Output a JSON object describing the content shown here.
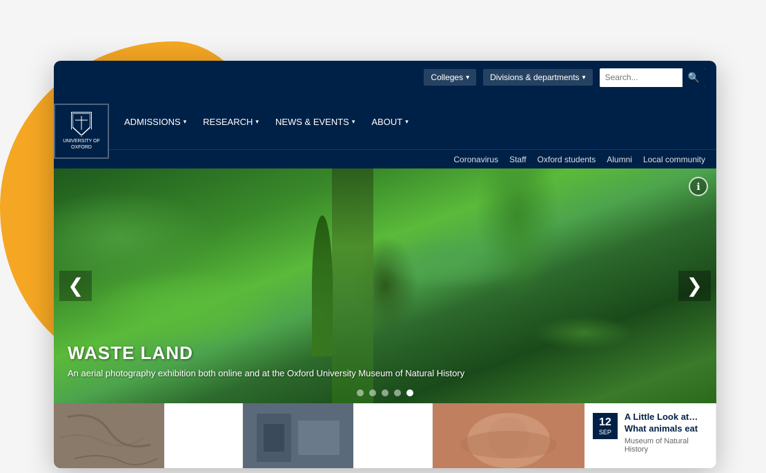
{
  "page": {
    "title": "University of Oxford"
  },
  "background": {
    "blob_color": "#F5A623"
  },
  "navbar": {
    "logo": {
      "line1": "UNIVERSITY OF",
      "line2": "OXFORD"
    },
    "top_right": {
      "colleges_label": "Colleges",
      "divisions_label": "Divisions & departments",
      "search_placeholder": "Search..."
    },
    "main_links": [
      {
        "label": "ADMISSIONS",
        "id": "admissions"
      },
      {
        "label": "RESEARCH",
        "id": "research"
      },
      {
        "label": "NEWS & EVENTS",
        "id": "news-events"
      },
      {
        "label": "ABOUT",
        "id": "about"
      }
    ],
    "secondary_links": [
      {
        "label": "Coronavirus",
        "id": "coronavirus"
      },
      {
        "label": "Staff",
        "id": "staff"
      },
      {
        "label": "Oxford students",
        "id": "oxford-students"
      },
      {
        "label": "Alumni",
        "id": "alumni"
      },
      {
        "label": "Local community",
        "id": "local-community"
      }
    ]
  },
  "hero": {
    "title": "WASTE LAND",
    "subtitle": "An aerial photography exhibition both online and at the Oxford University Museum of Natural History",
    "prev_label": "❮",
    "next_label": "❯",
    "info_label": "ℹ",
    "dots": [
      {
        "active": false
      },
      {
        "active": false
      },
      {
        "active": false
      },
      {
        "active": false
      },
      {
        "active": true
      }
    ]
  },
  "news": [
    {
      "id": "news-1",
      "thumb_class": "news-thumb-1",
      "has_date": false
    },
    {
      "id": "news-2",
      "thumb_class": "news-thumb-2",
      "has_date": false
    },
    {
      "id": "news-3",
      "thumb_class": "news-thumb-3",
      "has_date": true,
      "date_day": "12",
      "date_month": "SEP",
      "title": "A Little Look at… What animals eat",
      "venue": "Museum of Natural History"
    }
  ]
}
